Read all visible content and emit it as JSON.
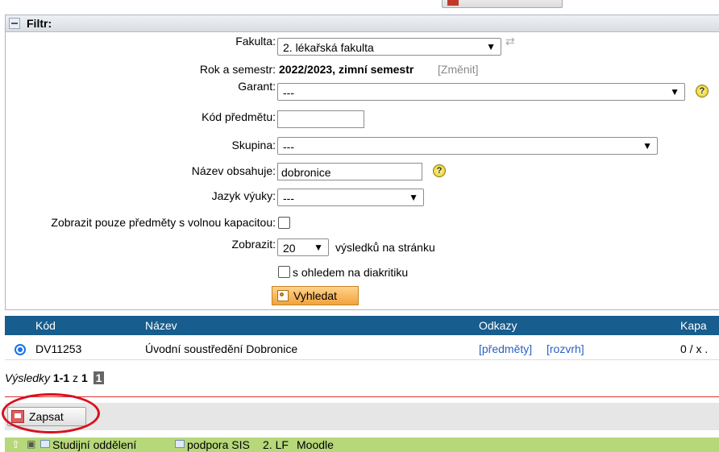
{
  "filter": {
    "header": "Filtr:",
    "fakulta_label": "Fakulta:",
    "fakulta_value": "2. lékařská fakulta",
    "rok_label": "Rok a semestr:",
    "rok_value": "2022/2023, zimní semestr",
    "zmenit": "[Změnit]",
    "garant_label": "Garant:",
    "garant_value": "---",
    "kod_label": "Kód předmětu:",
    "kod_value": "",
    "skupina_label": "Skupina:",
    "skupina_value": "---",
    "nazev_label": "Název obsahuje:",
    "nazev_value": "dobronice",
    "jazyk_label": "Jazyk výuky:",
    "jazyk_value": "---",
    "volna_label": "Zobrazit pouze předměty s volnou kapacitou:",
    "zobrazit_label": "Zobrazit:",
    "zobrazit_value": "20",
    "zobrazit_suffix": "výsledků na stránku",
    "diakritika_label": "s ohledem na diakritiku",
    "search_button": "Vyhledat"
  },
  "table": {
    "headers": [
      "Kód",
      "Název",
      "Odkazy",
      "Kapa"
    ],
    "rows": [
      {
        "kod": "DV11253",
        "nazev": "Úvodní soustředění Dobronice",
        "predmety": "[předměty]",
        "rozvrh": "[rozvrh]",
        "kapacita": "0 / x ."
      }
    ]
  },
  "results": {
    "label": "Výsledky",
    "range": "1-1",
    "of": "z",
    "total": "1",
    "page": "1"
  },
  "actions": {
    "zapsat": "Zapsat"
  },
  "footer": {
    "links": [
      "Studijní oddělení",
      "podpora SIS",
      "2. LF",
      "Moodle"
    ]
  },
  "colors": {
    "table_header": "#175d8d",
    "footer_bar": "#b6d77a",
    "highlight_circle": "#d9101f",
    "search_button": "#f2a33c"
  }
}
